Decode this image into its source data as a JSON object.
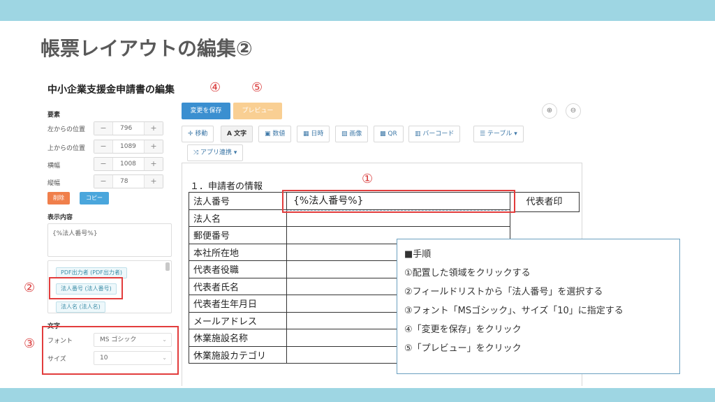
{
  "slide": {
    "title": "帳票レイアウトの編集②"
  },
  "app": {
    "title": "中小企業支援金申請書の編集",
    "element_section": "要素",
    "props": [
      {
        "label": "左からの位置",
        "value": "796"
      },
      {
        "label": "上からの位置",
        "value": "1089"
      },
      {
        "label": "横幅",
        "value": "1008"
      },
      {
        "label": "縦幅",
        "value": "78"
      }
    ],
    "minus": "−",
    "plus": "+",
    "delete_label": "削除",
    "copy_label": "コピー",
    "display_section": "表示内容",
    "display_value": "{%法人番号%}",
    "field_list": [
      "PDF出力者 (PDF出力者)",
      "法人番号 (法人番号)",
      "法人名 (法人名)"
    ],
    "text_section": "文字",
    "font_label": "フォント",
    "font_value": "MS ゴシック",
    "size_label": "サイズ",
    "size_value": "10",
    "save_label": "変更を保存",
    "preview_label": "プレビュー",
    "zoom_in": "⊕",
    "zoom_out": "⊖",
    "toolbar": {
      "move": "✛ 移動",
      "text": "A 文字",
      "number": "▣ 数値",
      "date": "▦ 日時",
      "image": "▨ 画像",
      "qr": "▩ QR",
      "barcode": "▥ バーコード",
      "table": "☰ テーブル ▾",
      "app_link": "⤨ アプリ連携 ▾"
    }
  },
  "form": {
    "title": "１．申請者の情報",
    "rows": [
      "法人番号",
      "法人名",
      "郵便番号",
      "本社所在地",
      "代表者役職",
      "代表者氏名",
      "代表者生年月日",
      "メールアドレス",
      "休業施設名称",
      "休業施設カテゴリ"
    ],
    "seal_label": "代表者印",
    "placeholder": "{%法人番号%}"
  },
  "markers": {
    "m1": "①",
    "m2": "②",
    "m3": "③",
    "m4": "④",
    "m5": "⑤"
  },
  "steps": [
    "■手順",
    "①配置した領域をクリックする",
    "②フィールドリストから「法人番号」を選択する",
    "③フォント「MSゴシック」、サイズ「10」に指定する",
    "④「変更を保存」をクリック",
    "⑤「プレビュー」をクリック"
  ],
  "colors": {
    "band": "#9ed6e3",
    "marker_red": "#e23c3c",
    "save_blue": "#3b8fd0",
    "preview_orange": "#f9cf93",
    "delete_orange": "#f07f4b",
    "copy_blue": "#4aa6dc"
  }
}
